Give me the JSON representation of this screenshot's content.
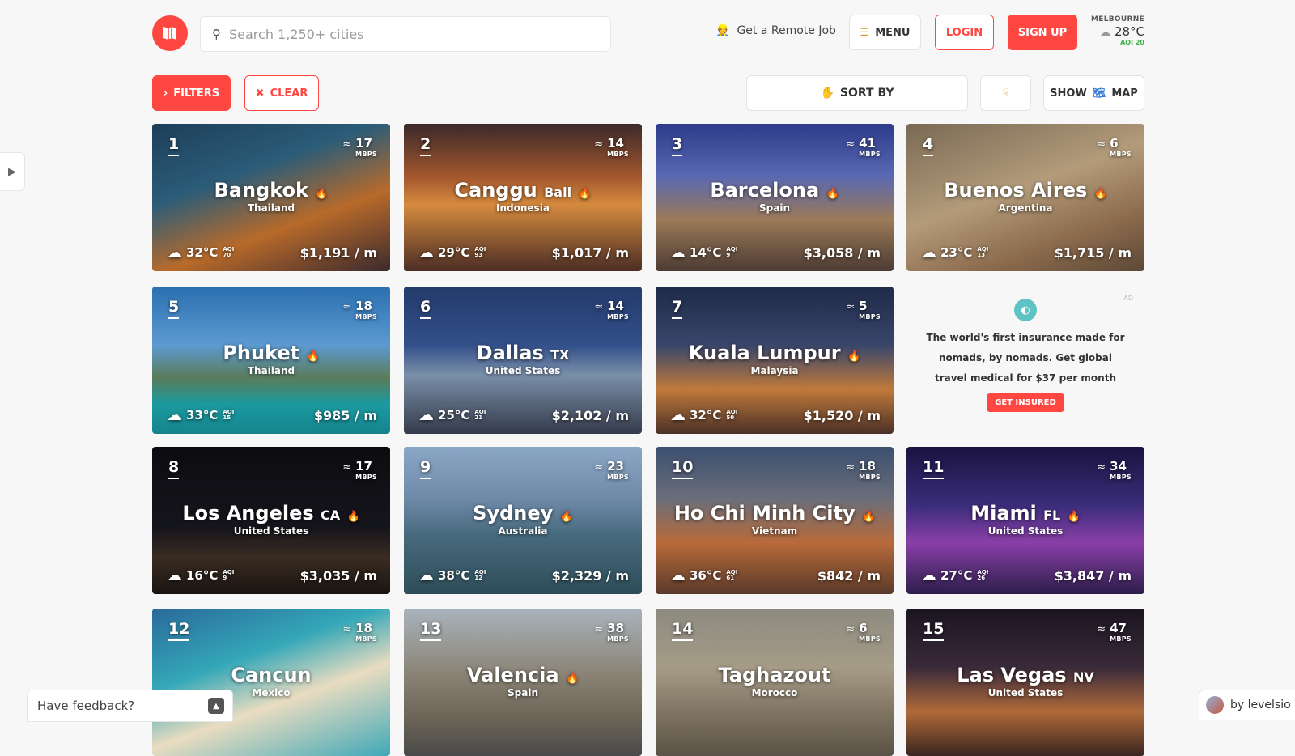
{
  "header": {
    "search_placeholder": "Search 1,250+ cities",
    "remote_job": "Get a Remote Job",
    "menu": "MENU",
    "login": "LOGIN",
    "signup": "SIGN UP",
    "weather": {
      "city": "MELBOURNE",
      "temp": "28°C",
      "aqi": "AQI 20"
    }
  },
  "toolbar": {
    "filters": "FILTERS",
    "clear": "CLEAR",
    "sort_by": "SORT BY",
    "show": "SHOW",
    "map": "MAP"
  },
  "colors": {
    "accent": "#ff4742",
    "aqi_good": "#3db24b"
  },
  "cities": [
    {
      "rank": "1",
      "name": "Bangkok",
      "sub": "",
      "country": "Thailand",
      "mbps": "17",
      "temp": "32°C",
      "aqi": "70",
      "cost": "$1,191 / m",
      "hot": true,
      "bg": "linear-gradient(160deg,#1d3f5a 0%,#2b5c78 35%,#b86a2a 65%,#3b2a2e 100%)"
    },
    {
      "rank": "2",
      "name": "Canggu",
      "sub": "Bali",
      "country": "Indonesia",
      "mbps": "14",
      "temp": "29°C",
      "aqi": "93",
      "cost": "$1,017 / m",
      "hot": true,
      "bg": "linear-gradient(180deg,#3a2a2a 0%,#a1552d 35%,#d58a3e 55%,#4b2d25 100%)"
    },
    {
      "rank": "3",
      "name": "Barcelona",
      "sub": "",
      "country": "Spain",
      "mbps": "41",
      "temp": "14°C",
      "aqi": "9",
      "cost": "$3,058 / m",
      "hot": true,
      "bg": "linear-gradient(180deg,#2d3b8a 0%,#5868b2 35%,#9b7a58 65%,#4d3b33 100%)"
    },
    {
      "rank": "4",
      "name": "Buenos Aires",
      "sub": "",
      "country": "Argentina",
      "mbps": "6",
      "temp": "23°C",
      "aqi": "13",
      "cost": "$1,715 / m",
      "hot": true,
      "bg": "linear-gradient(160deg,#7a6a55 0%,#b39b7a 45%,#8b6a4c 75%,#5c4938 100%)"
    },
    {
      "rank": "5",
      "name": "Phuket",
      "sub": "",
      "country": "Thailand",
      "mbps": "18",
      "temp": "33°C",
      "aqi": "15",
      "cost": "$985 / m",
      "hot": true,
      "bg": "linear-gradient(180deg,#2a6fb0 0%,#5d9ad0 40%,#5a7c5a 62%,#1a9aa0 80%,#16838c 100%)"
    },
    {
      "rank": "6",
      "name": "Dallas",
      "sub": "TX",
      "country": "United States",
      "mbps": "14",
      "temp": "25°C",
      "aqi": "21",
      "cost": "$2,102 / m",
      "hot": false,
      "bg": "linear-gradient(180deg,#233a6b 0%,#33508a 40%,#7a8fa9 60%,#343a4a 100%)"
    },
    {
      "rank": "7",
      "name": "Kuala Lumpur",
      "sub": "",
      "country": "Malaysia",
      "mbps": "5",
      "temp": "32°C",
      "aqi": "50",
      "cost": "$1,520 / m",
      "hot": true,
      "bg": "linear-gradient(180deg,#1f2a48 0%,#39466b 40%,#c07a3a 70%,#4a3028 100%)"
    },
    {
      "rank": "8",
      "name": "Los Angeles",
      "sub": "CA",
      "country": "United States",
      "mbps": "17",
      "temp": "16°C",
      "aqi": "9",
      "cost": "$3,035 / m",
      "hot": true,
      "bg": "linear-gradient(180deg,#0c0c10 0%,#15151c 55%,#3a2c22 75%,#1a1410 100%)"
    },
    {
      "rank": "9",
      "name": "Sydney",
      "sub": "",
      "country": "Australia",
      "mbps": "23",
      "temp": "38°C",
      "aqi": "12",
      "cost": "$2,329 / m",
      "hot": true,
      "bg": "linear-gradient(180deg,#8ba7c6 0%,#6f8aa8 35%,#476a7d 60%,#2e4d59 100%)"
    },
    {
      "rank": "10",
      "name": "Ho Chi Minh City",
      "sub": "",
      "country": "Vietnam",
      "mbps": "18",
      "temp": "36°C",
      "aqi": "61",
      "cost": "$842 / m",
      "hot": true,
      "bg": "linear-gradient(180deg,#3c4f70 0%,#6a6e7a 35%,#b86a3a 65%,#5a3a2a 100%)"
    },
    {
      "rank": "11",
      "name": "Miami",
      "sub": "FL",
      "country": "United States",
      "mbps": "34",
      "temp": "27°C",
      "aqi": "26",
      "cost": "$3,847 / m",
      "hot": true,
      "bg": "linear-gradient(180deg,#1a1340 0%,#3b2d7a 40%,#8a3fa8 65%,#2c1e4a 100%)"
    },
    {
      "rank": "12",
      "name": "Cancun",
      "sub": "",
      "country": "Mexico",
      "mbps": "18",
      "temp": "",
      "aqi": "",
      "cost": "",
      "hot": false,
      "bg": "linear-gradient(160deg,#2a6a9a 0%,#34a7b8 35%,#e9dcc0 60%,#3fa8b8 100%)"
    },
    {
      "rank": "13",
      "name": "Valencia",
      "sub": "",
      "country": "Spain",
      "mbps": "38",
      "temp": "",
      "aqi": "",
      "cost": "",
      "hot": true,
      "bg": "linear-gradient(180deg,#a9b3bd 0%,#8a8375 45%,#6b6356 75%,#4a4a4a 100%)"
    },
    {
      "rank": "14",
      "name": "Taghazout",
      "sub": "",
      "country": "Morocco",
      "mbps": "6",
      "temp": "",
      "aqi": "",
      "cost": "",
      "hot": false,
      "bg": "linear-gradient(180deg,#8c8a80 0%,#a59b86 40%,#7a6f5d 75%,#5a5246 100%)"
    },
    {
      "rank": "15",
      "name": "Las Vegas",
      "sub": "NV",
      "country": "United States",
      "mbps": "47",
      "temp": "",
      "aqi": "",
      "cost": "",
      "hot": false,
      "bg": "linear-gradient(180deg,#1a1520 0%,#3a2a3a 40%,#b06a3a 70%,#3a2520 100%)"
    }
  ],
  "mbps_unit": "MBPS",
  "aqi_label": "AQI",
  "ad": {
    "label": "AD",
    "text": "The world's first insurance made for nomads, by nomads. Get global travel medical for $37 per month",
    "cta": "GET INSURED"
  },
  "feedback": "Have feedback?",
  "byline": "by levelsio"
}
